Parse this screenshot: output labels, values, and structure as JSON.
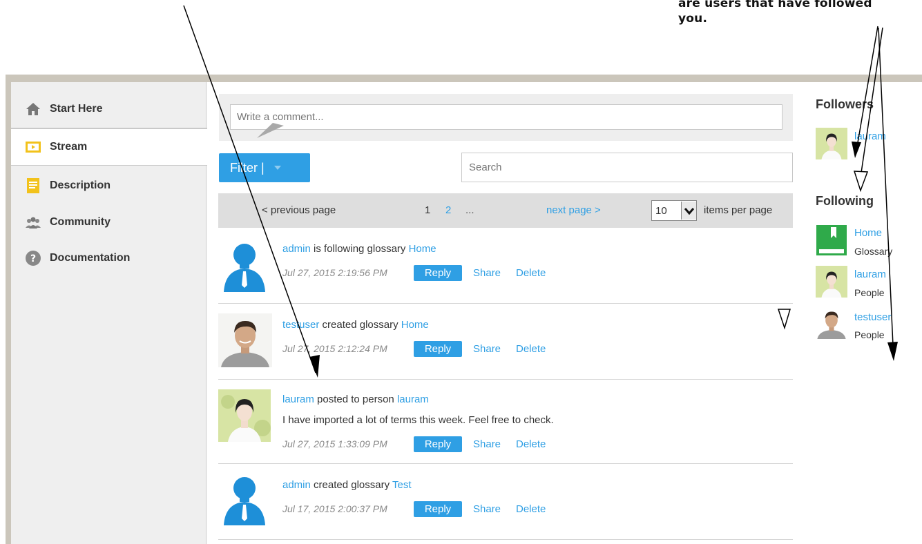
{
  "annotation": {
    "lines": [
      "are users that have followed",
      "you."
    ]
  },
  "sidebar": {
    "items": [
      {
        "label": "Start Here",
        "icon": "home-icon"
      },
      {
        "label": "Stream",
        "icon": "stream-icon"
      },
      {
        "label": "Description",
        "icon": "description-icon"
      },
      {
        "label": "Community",
        "icon": "community-icon"
      },
      {
        "label": "Documentation",
        "icon": "help-icon"
      }
    ],
    "active": "Stream"
  },
  "comment": {
    "placeholder": "Write a comment..."
  },
  "toolbar": {
    "filter_label": "Filter |",
    "search_placeholder": "Search"
  },
  "pager": {
    "prev_label": "< previous page",
    "page1": "1",
    "page2": "2",
    "ellipsis": "...",
    "next_label": "next page >",
    "items_per_page_value": "10",
    "items_per_page_label": "items per page"
  },
  "feed": [
    {
      "user": "admin",
      "action": " is following glossary ",
      "target": "Home",
      "message": "",
      "timestamp": "Jul 27, 2015 2:19:56 PM",
      "avatar": "silhouette"
    },
    {
      "user": "testuser",
      "action": " created glossary ",
      "target": "Home",
      "message": "",
      "timestamp": "Jul 27, 2015 2:12:24 PM",
      "avatar": "man-photo"
    },
    {
      "user": "lauram",
      "action": " posted to person ",
      "target": "lauram",
      "message": "I have imported a lot of terms this week. Feel free to check.",
      "timestamp": "Jul 27, 2015 1:33:09 PM",
      "avatar": "woman-photo"
    },
    {
      "user": "admin",
      "action": " created glossary ",
      "target": "Test",
      "message": "",
      "timestamp": "Jul 17, 2015 2:00:37 PM",
      "avatar": "silhouette"
    }
  ],
  "actions": {
    "reply": "Reply",
    "share": "Share",
    "delete": "Delete"
  },
  "followers": {
    "title": "Followers",
    "items": [
      {
        "name": "lauram"
      }
    ]
  },
  "following": {
    "title": "Following",
    "items": [
      {
        "name": "Home",
        "type": "Glossary"
      },
      {
        "name": "lauram",
        "type": "People"
      },
      {
        "name": "testuser",
        "type": "People"
      }
    ]
  },
  "colors": {
    "accent": "#2f9fe4",
    "sidebar": "#efefef",
    "frame": "#cbc6bb"
  }
}
